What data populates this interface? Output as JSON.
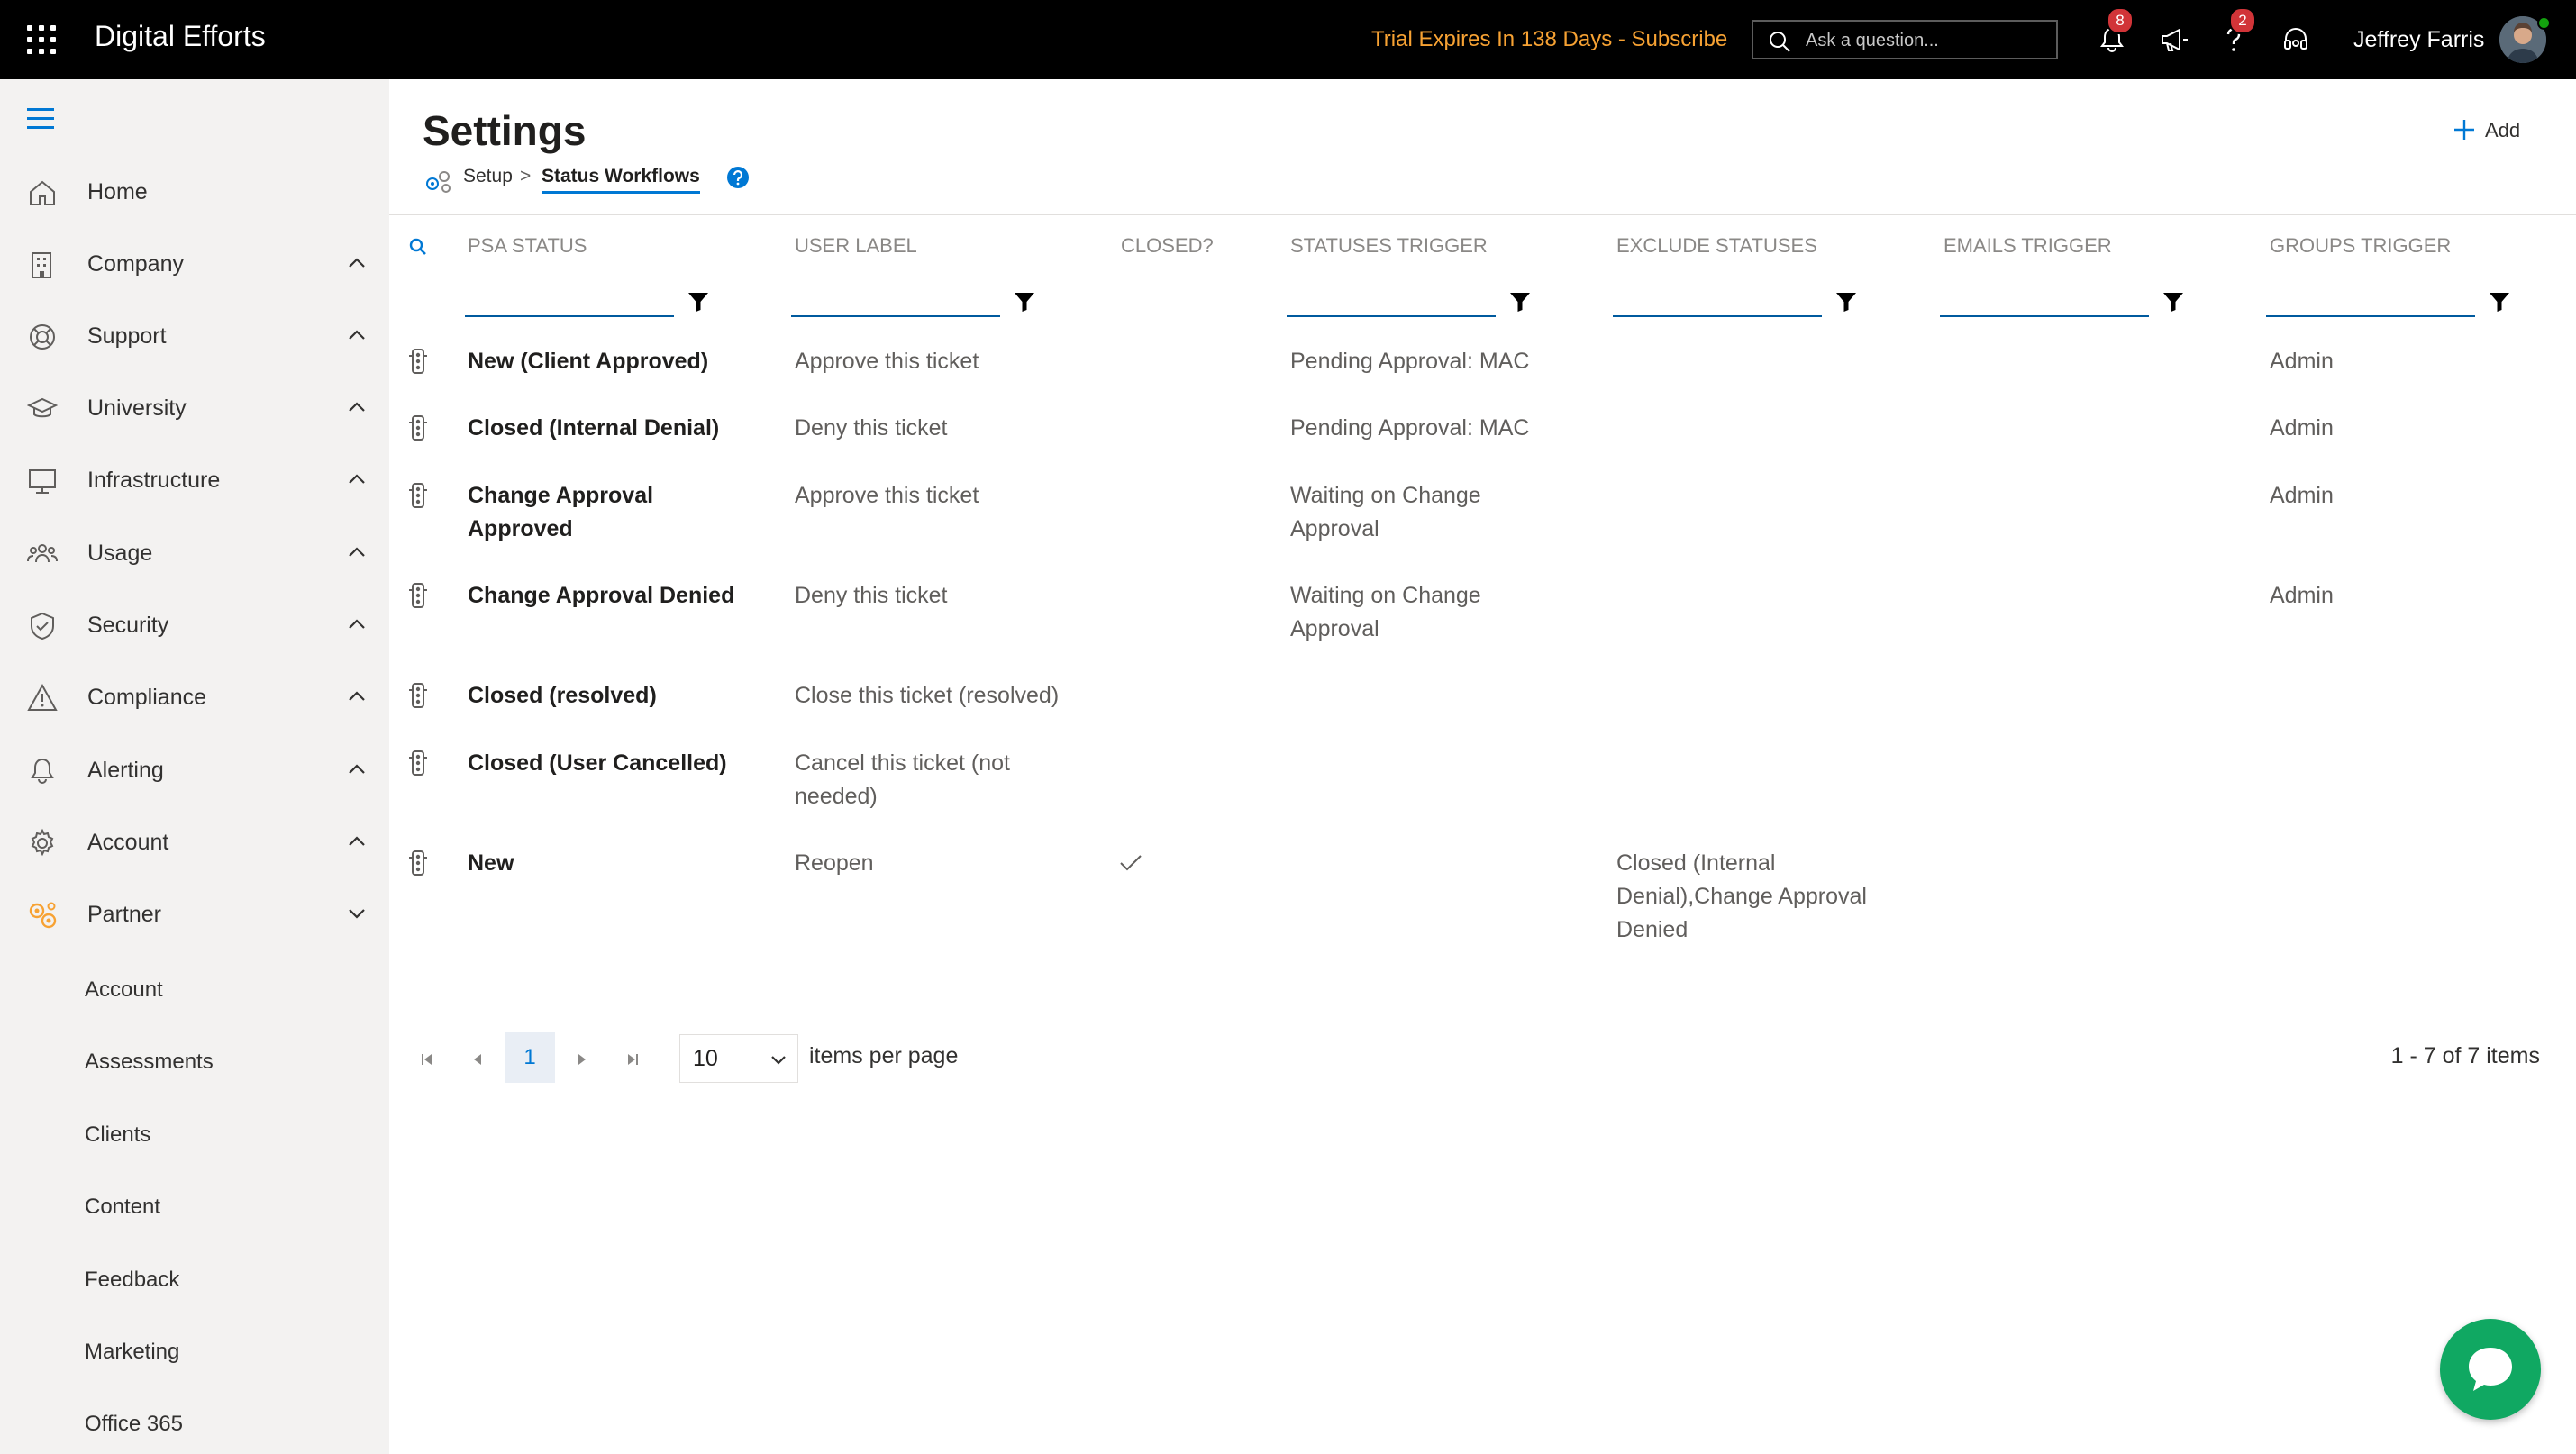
{
  "topbar": {
    "app_title": "Digital Efforts",
    "trial_text": "Trial Expires In 138 Days - Subscribe",
    "search_placeholder": "Ask a question...",
    "notifications_badge": "8",
    "help_badge": "2",
    "user_name": "Jeffrey Farris"
  },
  "sidebar": {
    "items": [
      {
        "label": "Home",
        "icon": "home-icon"
      },
      {
        "label": "Company",
        "icon": "building-icon"
      },
      {
        "label": "Support",
        "icon": "lifebuoy-icon"
      },
      {
        "label": "University",
        "icon": "graduation-cap-icon"
      },
      {
        "label": "Infrastructure",
        "icon": "monitor-icon"
      },
      {
        "label": "Usage",
        "icon": "people-icon"
      },
      {
        "label": "Security",
        "icon": "shield-icon"
      },
      {
        "label": "Compliance",
        "icon": "warning-icon"
      },
      {
        "label": "Alerting",
        "icon": "bell-icon"
      },
      {
        "label": "Account",
        "icon": "gear-icon"
      },
      {
        "label": "Partner",
        "icon": "partner-gears-icon"
      }
    ],
    "partner_subitems": [
      "Account",
      "Assessments",
      "Clients",
      "Content",
      "Feedback",
      "Marketing",
      "Office 365"
    ]
  },
  "main": {
    "title": "Settings",
    "breadcrumb": {
      "root": "Setup",
      "separator": ">",
      "current": "Status Workflows"
    },
    "add_label": "Add",
    "accent_color": "#0078d4"
  },
  "table": {
    "columns": [
      "PSA STATUS",
      "USER LABEL",
      "CLOSED?",
      "STATUSES TRIGGER",
      "EXCLUDE STATUSES",
      "EMAILS TRIGGER",
      "GROUPS TRIGGER"
    ],
    "rows": [
      {
        "psa_status": "New (Client Approved)",
        "user_label": "Approve this ticket",
        "closed": false,
        "statuses_trigger": "Pending Approval: MAC",
        "exclude_statuses": "",
        "emails_trigger": "",
        "groups_trigger": "Admin"
      },
      {
        "psa_status": "Closed (Internal Denial)",
        "user_label": "Deny this ticket",
        "closed": false,
        "statuses_trigger": "Pending Approval: MAC",
        "exclude_statuses": "",
        "emails_trigger": "",
        "groups_trigger": "Admin"
      },
      {
        "psa_status": "Change Approval Approved",
        "user_label": "Approve this ticket",
        "closed": false,
        "statuses_trigger": "Waiting on Change Approval",
        "exclude_statuses": "",
        "emails_trigger": "",
        "groups_trigger": "Admin"
      },
      {
        "psa_status": "Change Approval Denied",
        "user_label": "Deny this ticket",
        "closed": false,
        "statuses_trigger": "Waiting on Change Approval",
        "exclude_statuses": "",
        "emails_trigger": "",
        "groups_trigger": "Admin"
      },
      {
        "psa_status": "Closed (resolved)",
        "user_label": "Close this ticket (resolved)",
        "closed": false,
        "statuses_trigger": "",
        "exclude_statuses": "",
        "emails_trigger": "",
        "groups_trigger": ""
      },
      {
        "psa_status": "Closed (User Cancelled)",
        "user_label": "Cancel this ticket (not needed)",
        "closed": false,
        "statuses_trigger": "",
        "exclude_statuses": "",
        "emails_trigger": "",
        "groups_trigger": ""
      },
      {
        "psa_status": "New",
        "user_label": "Reopen",
        "closed": true,
        "statuses_trigger": "",
        "exclude_statuses": "Closed (Internal Denial),Change Approval Denied",
        "emails_trigger": "",
        "groups_trigger": ""
      }
    ]
  },
  "pager": {
    "current_page": "1",
    "page_size": "10",
    "page_size_label": "items per page",
    "info": "1 - 7 of 7 items"
  }
}
